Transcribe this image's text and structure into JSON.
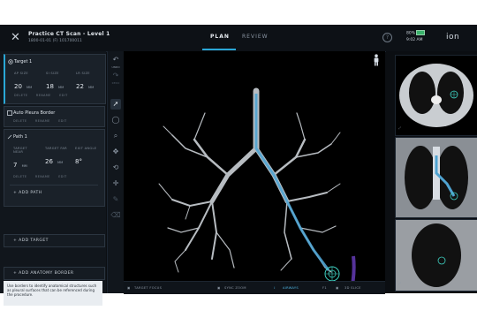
{
  "header": {
    "title": "Practice CT Scan - Level 1",
    "subtitle": "1800-01-01  (F)  101700011",
    "tabs": [
      {
        "label": "PLAN"
      },
      {
        "label": "REVIEW"
      }
    ],
    "help": "?",
    "status": {
      "battery": "80%",
      "time": "9:02 AM"
    },
    "logo": "ion"
  },
  "sidebar": {
    "target": {
      "title": "Target 1",
      "fields": [
        {
          "label": "AP SIZE",
          "value": "20",
          "unit": "MM"
        },
        {
          "label": "SI SIZE",
          "value": "18",
          "unit": "MM"
        },
        {
          "label": "LR SIZE",
          "value": "22",
          "unit": "MM"
        }
      ],
      "actions": [
        "DELETE",
        "RENAME",
        "EDIT"
      ]
    },
    "pleura": {
      "title": "Auto Pleura Border",
      "actions": [
        "DELETE",
        "RENAME",
        "EDIT"
      ]
    },
    "path": {
      "title": "Path 1",
      "fields": [
        {
          "label": "TARGET NEAR",
          "value": "7",
          "unit": "MM"
        },
        {
          "label": "TARGET FAR",
          "value": "26",
          "unit": "MM"
        },
        {
          "label": "EXIT ANGLE",
          "value": "8°",
          "unit": ""
        }
      ],
      "actions": [
        "DELETE",
        "RENAME",
        "EDIT"
      ]
    },
    "add_path": "+  ADD PATH",
    "add_target": "+  ADD TARGET",
    "add_anatomy": "+  ADD ANATOMY BORDER",
    "tooltip": "Use borders to identify anatomical structures such as pleural surfaces that can be referenced during the procedure."
  },
  "toolbar": {
    "undo": "UNDO",
    "redo": "REDO"
  },
  "bottombar": {
    "target_focus": "TARGET FOCUS",
    "sync_zoom": "SYNC ZOOM",
    "airways": "AIRWAYS",
    "pin": "F1",
    "3d_slice": "3D SLICE"
  },
  "colors": {
    "accent": "#2aa7d6",
    "airway": "#4fa3d1",
    "target": "#3ecfc0",
    "border": "#6a3ec0"
  }
}
